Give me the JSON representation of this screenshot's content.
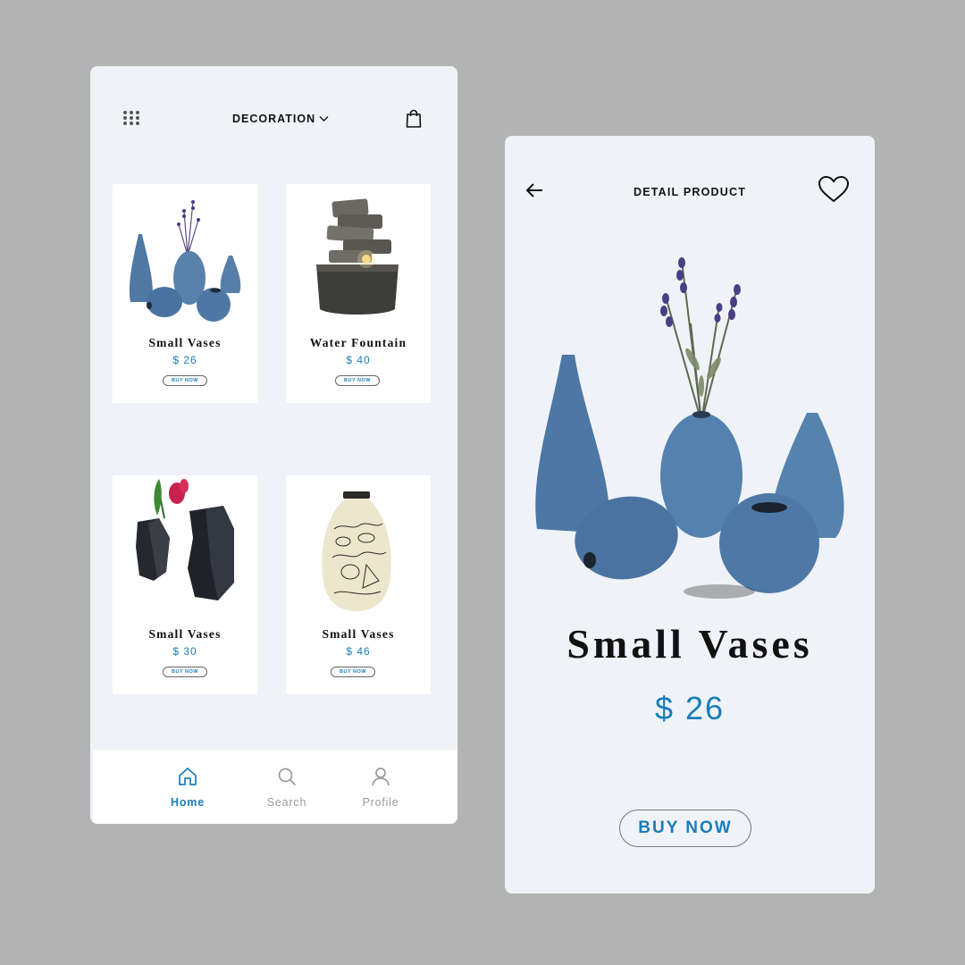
{
  "home": {
    "category_label": "DECORATION",
    "icons": {
      "menu": "grid-icon",
      "cart": "shopping-bag-icon",
      "dropdown": "chevron-down-icon"
    },
    "products": [
      {
        "name": "Small Vases",
        "price": "$ 26",
        "buy_label": "BUY NOW",
        "image": "blue-vases-with-lavender"
      },
      {
        "name": "Water Fountain",
        "price": "$ 40",
        "buy_label": "BUY NOW",
        "image": "stone-water-fountain"
      },
      {
        "name": "Small Vases",
        "price": "$ 30",
        "buy_label": "BUY NOW",
        "image": "black-vases-with-red-flower"
      },
      {
        "name": "Small Vases",
        "price": "$ 46",
        "buy_label": "BUY NOW",
        "image": "cream-painted-vase"
      }
    ],
    "nav": [
      {
        "label": "Home",
        "icon": "home-icon",
        "active": true
      },
      {
        "label": "Search",
        "icon": "search-icon",
        "active": false
      },
      {
        "label": "Profile",
        "icon": "user-icon",
        "active": false
      }
    ]
  },
  "detail": {
    "title": "DETAIL PRODUCT",
    "icons": {
      "back": "arrow-left-icon",
      "favorite": "heart-icon"
    },
    "product_name": "Small Vases",
    "price": "$ 26",
    "buy_label": "BUY NOW",
    "image": "blue-vases-with-lavender"
  },
  "colors": {
    "background": "#b3b3b3",
    "screen": "#eff3f8",
    "accent": "#1a7db8",
    "vase_blue": "#4f78a3"
  }
}
